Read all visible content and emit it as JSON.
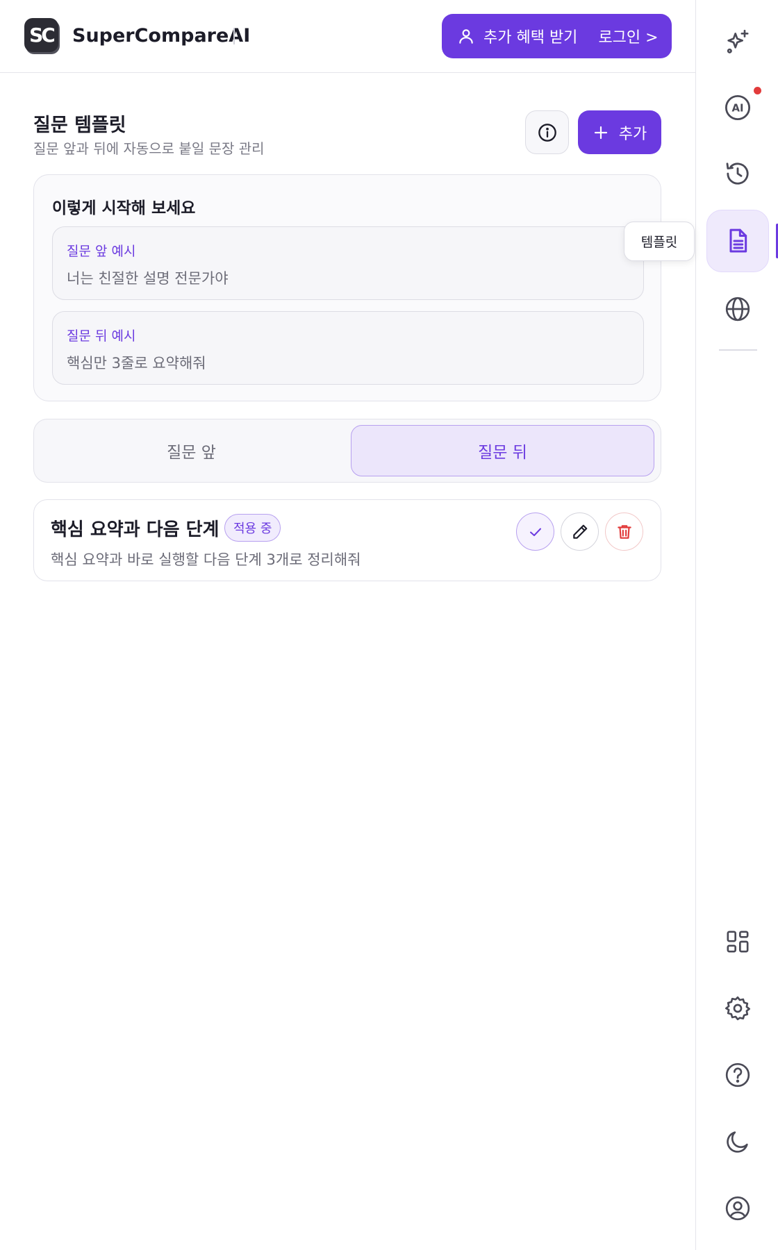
{
  "header": {
    "logo_text": "SC",
    "app_title": "SuperCompareAI",
    "promo_label": "추가 혜택 받기",
    "login_label": "로그인 >"
  },
  "section": {
    "title": "질문 템플릿",
    "subtitle": "질문 앞과 뒤에 자동으로 붙일 문장 관리",
    "add_label": "추가"
  },
  "examples": {
    "title": "이렇게 시작해 보세요",
    "items": [
      {
        "label": "질문 앞 예시",
        "text": "너는 친절한 설명 전문가야"
      },
      {
        "label": "질문 뒤 예시",
        "text": "핵심만 3줄로 요약해줘"
      }
    ]
  },
  "segmented": {
    "options": [
      "질문 앞",
      "질문 뒤"
    ],
    "selected": "질문 뒤"
  },
  "templates": [
    {
      "name": "핵심 요약과 다음 단계",
      "badge": "적용 중",
      "description": "핵심 요약과 바로 실행할 다음 단계 3개로 정리해줘"
    }
  ],
  "rail": {
    "items": [
      "sparkles-icon",
      "ai-icon",
      "history-icon",
      "document-icon",
      "globe-icon",
      "grid-icon",
      "settings-icon",
      "help-icon",
      "moon-icon",
      "user-circle-icon"
    ],
    "active": "document-icon",
    "tooltip": "템플릿"
  },
  "colors": {
    "accent": "#6b3ae0",
    "accent_soft": "#ece6fb",
    "danger": "#e23b3b",
    "text": "#1c1c28",
    "muted": "#6c6c78"
  }
}
